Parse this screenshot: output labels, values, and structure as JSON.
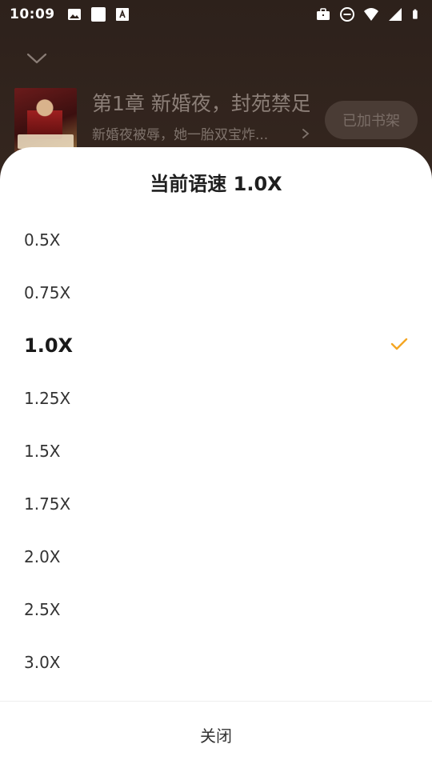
{
  "status_bar": {
    "time": "10:09",
    "left_icons": [
      "image-icon",
      "white-square-icon",
      "text-a-icon"
    ],
    "right_icons": [
      "briefcase-icon",
      "do-not-disturb-icon",
      "wifi-icon",
      "signal-icon",
      "battery-icon"
    ]
  },
  "background": {
    "book": {
      "title": "第1章 新婚夜，封苑禁足",
      "description": "新婚夜被辱，她一胎双宝炸...",
      "shelf_button": "已加书架"
    }
  },
  "sheet": {
    "title": "当前语速 1.0X",
    "speeds": [
      {
        "label": "0.5X",
        "selected": false
      },
      {
        "label": "0.75X",
        "selected": false
      },
      {
        "label": "1.0X",
        "selected": true
      },
      {
        "label": "1.25X",
        "selected": false
      },
      {
        "label": "1.5X",
        "selected": false
      },
      {
        "label": "1.75X",
        "selected": false
      },
      {
        "label": "2.0X",
        "selected": false
      },
      {
        "label": "2.5X",
        "selected": false
      },
      {
        "label": "3.0X",
        "selected": false
      }
    ],
    "close_label": "关闭"
  },
  "colors": {
    "accent": "#f5a623",
    "sheet_bg": "#ffffff",
    "scrim": "#2d211b"
  }
}
